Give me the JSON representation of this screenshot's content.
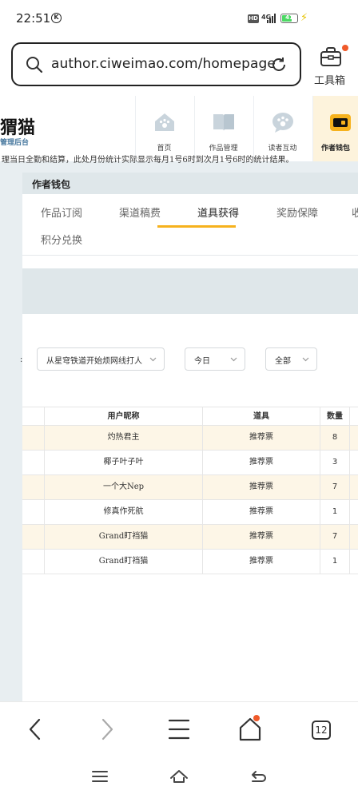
{
  "status_bar": {
    "time": "22:51",
    "k_icon": "K",
    "hd": "HD",
    "network": "4G",
    "battery": "41"
  },
  "browser": {
    "url": "author.ciweimao.com/homepage",
    "toolbox_label": "工具箱"
  },
  "site": {
    "logo": "猬猫",
    "logo_sub": "管理后台",
    "nav": [
      {
        "label": "首页",
        "icon": "paw-house-icon"
      },
      {
        "label": "作品管理",
        "icon": "book-icon"
      },
      {
        "label": "读者互动",
        "icon": "paw-chat-icon"
      },
      {
        "label": "作者钱包",
        "icon": "wallet-icon"
      }
    ]
  },
  "panel": {
    "title": "作者钱包",
    "tabs": [
      "作品订阅",
      "渠道稿费",
      "道具获得",
      "奖励保障",
      "积分兑换"
    ],
    "active_tab": "道具获得",
    "notice": "理当日全勤和结算，此处月份统计实际显示每月1号6时到次月1号6时的统计结果。",
    "filters": {
      "book": "从星穹铁道开始烦网线打人",
      "date": "今日",
      "type": "全部"
    }
  },
  "table": {
    "headers": [
      "用户昵称",
      "道具",
      "数量"
    ],
    "rows": [
      {
        "user": "灼热君主",
        "item": "推荐票",
        "count": "8"
      },
      {
        "user": "椰子叶子叶",
        "item": "推荐票",
        "count": "3"
      },
      {
        "user": "一个大Nep",
        "item": "推荐票",
        "count": "7"
      },
      {
        "user": "修真作死航",
        "item": "推荐票",
        "count": "1"
      },
      {
        "user": "Grand盯裆猫",
        "item": "推荐票",
        "count": "7"
      },
      {
        "user": "Grand盯裆猫",
        "item": "推荐票",
        "count": "1"
      }
    ]
  },
  "bottom_nav": {
    "tabs_count": "12"
  },
  "colors": {
    "accent": "#f6b21d",
    "highlight_row": "#fdf6e7",
    "panel_band": "#dfe7ea",
    "badge": "#f05a2a"
  }
}
